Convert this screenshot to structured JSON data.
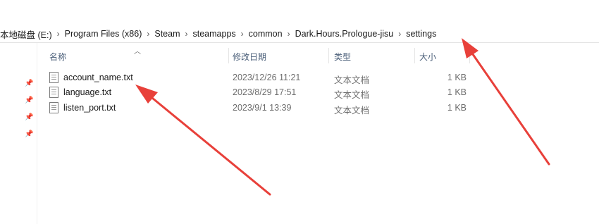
{
  "address_bar": {
    "segments": [
      "本地磁盘 (E:)",
      "Program Files (x86)",
      "Steam",
      "steamapps",
      "common",
      "Dark.Hours.Prologue-jisu",
      "settings"
    ]
  },
  "columns": {
    "name": "名称",
    "date": "修改日期",
    "type": "类型",
    "size": "大小"
  },
  "files": [
    {
      "name": "account_name.txt",
      "date": "2023/12/26 11:21",
      "type": "文本文档",
      "size": "1 KB"
    },
    {
      "name": "language.txt",
      "date": "2023/8/29 17:51",
      "type": "文本文档",
      "size": "1 KB"
    },
    {
      "name": "listen_port.txt",
      "date": "2023/9/1 13:39",
      "type": "文本文档",
      "size": "1 KB"
    }
  ],
  "icons": {
    "file": "text-file-icon",
    "pin": "pin-icon",
    "sort": "sort-up-icon",
    "breadcrumb_separator": "chevron-right-icon"
  },
  "colors": {
    "annotation_arrow": "#e8403a",
    "header_text": "#4c607a"
  }
}
